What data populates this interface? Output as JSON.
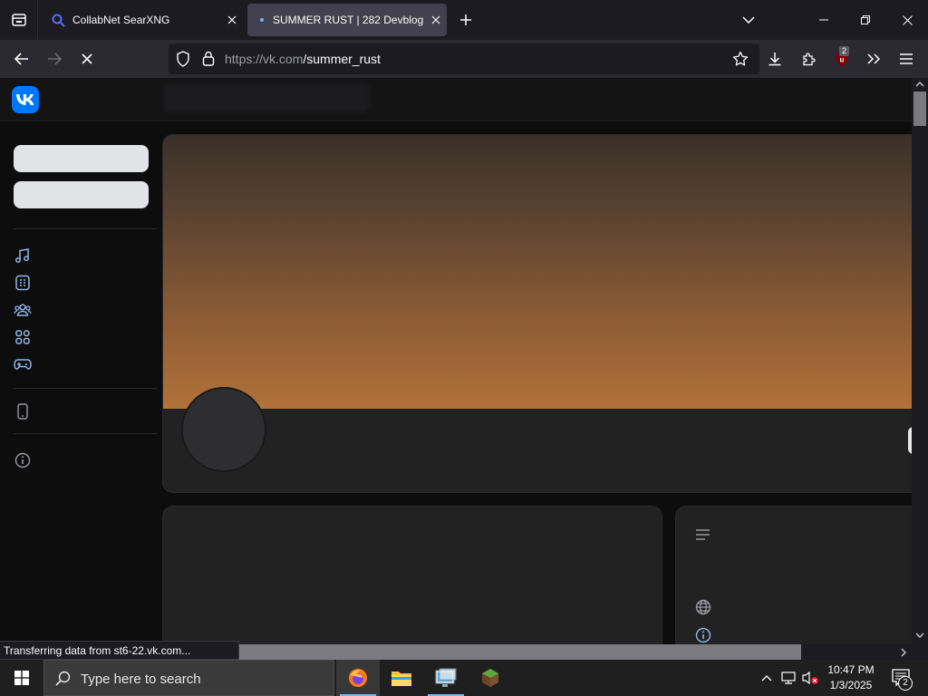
{
  "browser": {
    "tabs": [
      {
        "title": "CollabNet SearXNG",
        "active": false
      },
      {
        "title": "SUMMER RUST | 282 Devblog | ...",
        "active": true
      }
    ],
    "url_host": "https://vk.com",
    "url_path": "/summer_rust",
    "extension_badge": "2",
    "status_text": "Transferring data from st6-22.vk.com..."
  },
  "sidebar": {
    "icons": [
      "music-icon",
      "services-icon",
      "friends-icon",
      "apps-icon",
      "games-icon",
      "mobile-icon",
      "info-icon"
    ]
  },
  "page": {
    "right_card_icons": [
      "menu-lines-icon",
      "globe-icon",
      "info-icon"
    ]
  },
  "taskbar": {
    "search_placeholder": "Type here to search",
    "time": "10:47 PM",
    "date": "1/3/2025",
    "notification_count": "2",
    "apps": [
      "firefox",
      "file-explorer",
      "remote-desktop",
      "minecraft"
    ]
  },
  "colors": {
    "vk_blue": "#0077ff",
    "tab_active": "#42414d",
    "toolbar": "#2b2a33",
    "taskbar": "#1f1f1f"
  }
}
